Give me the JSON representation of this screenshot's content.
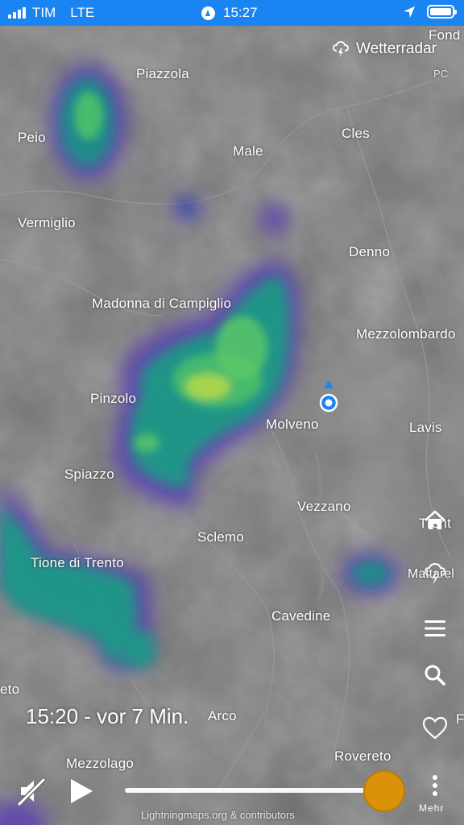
{
  "status_bar": {
    "carrier": "TIM",
    "network": "LTE",
    "time": "15:27",
    "battery_level": 1.0
  },
  "brand": {
    "name": "Wetterradar",
    "icon": "cloud-lightning-icon"
  },
  "map": {
    "places": [
      {
        "key": "fond",
        "name": "Fond"
      },
      {
        "key": "pc",
        "name": "PC"
      },
      {
        "key": "piazzola",
        "name": "Piazzola"
      },
      {
        "key": "peio",
        "name": "Peio"
      },
      {
        "key": "cles",
        "name": "Cles"
      },
      {
        "key": "male",
        "name": "Male"
      },
      {
        "key": "vermiglio",
        "name": "Vermiglio"
      },
      {
        "key": "denno",
        "name": "Denno"
      },
      {
        "key": "madonna",
        "name": "Madonna di Campiglio"
      },
      {
        "key": "mezzolombardo",
        "name": "Mezzolombardo"
      },
      {
        "key": "pinzolo",
        "name": "Pinzolo"
      },
      {
        "key": "molveno",
        "name": "Molveno"
      },
      {
        "key": "lavis",
        "name": "Lavis"
      },
      {
        "key": "spiazzo",
        "name": "Spiazzo"
      },
      {
        "key": "vezzano",
        "name": "Vezzano"
      },
      {
        "key": "trento",
        "name": "Trent"
      },
      {
        "key": "sclemo",
        "name": "Sclemo"
      },
      {
        "key": "tione",
        "name": "Tione di Trento"
      },
      {
        "key": "mattarello",
        "name": "Mattarel"
      },
      {
        "key": "cavedine",
        "name": "Cavedine"
      },
      {
        "key": "eto",
        "name": "eto"
      },
      {
        "key": "arco",
        "name": "Arco"
      },
      {
        "key": "f",
        "name": "F"
      },
      {
        "key": "rovereto",
        "name": "Rovereto"
      },
      {
        "key": "mezzolago",
        "name": "Mezzolago"
      }
    ]
  },
  "side_controls": [
    {
      "key": "home",
      "icon": "home-icon"
    },
    {
      "key": "lightning",
      "icon": "cloud-lightning-icon"
    },
    {
      "key": "menu",
      "icon": "menu-icon"
    },
    {
      "key": "search",
      "icon": "search-icon"
    },
    {
      "key": "favorite",
      "icon": "heart-icon"
    }
  ],
  "timeline": {
    "time_label": "15:20 - vor 7 Min.",
    "position": 1.0,
    "mute_icon": "speaker-muted-icon",
    "play_icon": "play-icon",
    "more_label": "Mehr",
    "more_icon": "more-vertical-icon"
  },
  "attribution": "Lightningmaps.org & contributors",
  "colors": {
    "status_bar": "#1a84f2",
    "slider_thumb": "#d9920a",
    "location": "#1a84f2"
  }
}
